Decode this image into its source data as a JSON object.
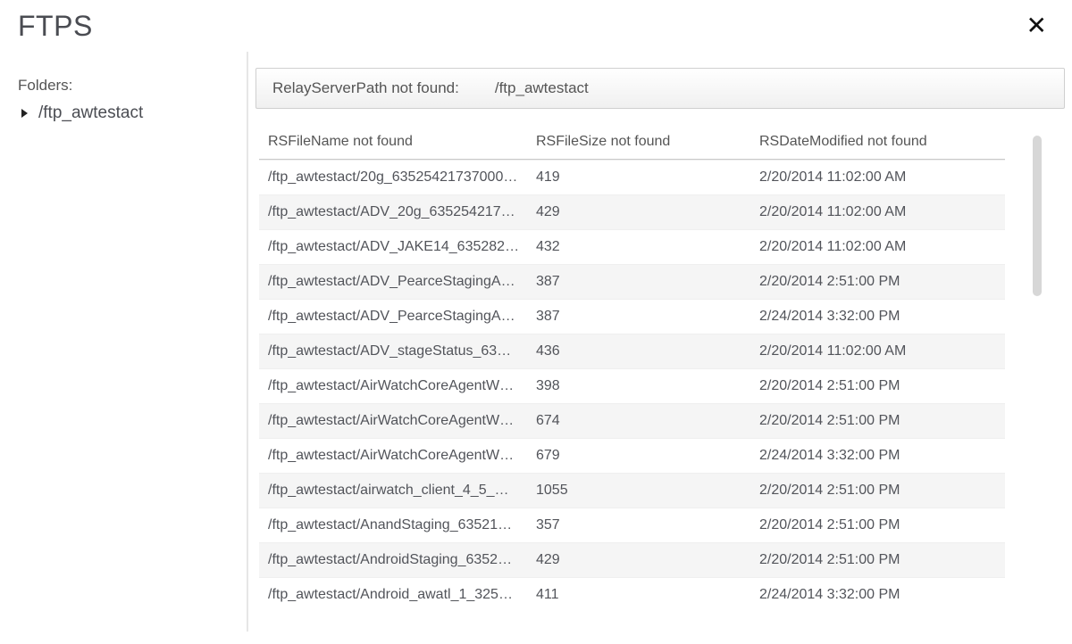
{
  "header": {
    "title": "FTPS"
  },
  "sidebar": {
    "label": "Folders:",
    "folder": "/ftp_awtestact"
  },
  "pathbar": {
    "label": "RelayServerPath not found:",
    "value": "/ftp_awtestact"
  },
  "table": {
    "columns": {
      "name": "RSFileName not found",
      "size": "RSFileSize not found",
      "modified": "RSDateModified not found"
    },
    "rows": [
      {
        "name": "/ftp_awtestact/20g_63525421737000…",
        "size": "419",
        "modified": "2/20/2014 11:02:00 AM"
      },
      {
        "name": "/ftp_awtestact/ADV_20g_635254217…",
        "size": "429",
        "modified": "2/20/2014 11:02:00 AM"
      },
      {
        "name": "/ftp_awtestact/ADV_JAKE14_635282…",
        "size": "432",
        "modified": "2/20/2014 11:02:00 AM"
      },
      {
        "name": "/ftp_awtestact/ADV_PearceStagingA…",
        "size": "387",
        "modified": "2/20/2014 2:51:00 PM"
      },
      {
        "name": "/ftp_awtestact/ADV_PearceStagingA…",
        "size": "387",
        "modified": "2/24/2014 3:32:00 PM"
      },
      {
        "name": "/ftp_awtestact/ADV_stageStatus_63…",
        "size": "436",
        "modified": "2/20/2014 11:02:00 AM"
      },
      {
        "name": "/ftp_awtestact/AirWatchCoreAgentW…",
        "size": "398",
        "modified": "2/20/2014 2:51:00 PM"
      },
      {
        "name": "/ftp_awtestact/AirWatchCoreAgentW…",
        "size": "674",
        "modified": "2/20/2014 2:51:00 PM"
      },
      {
        "name": "/ftp_awtestact/AirWatchCoreAgentW…",
        "size": "679",
        "modified": "2/24/2014 3:32:00 PM"
      },
      {
        "name": "/ftp_awtestact/airwatch_client_4_5_…",
        "size": "1055",
        "modified": "2/20/2014 2:51:00 PM"
      },
      {
        "name": "/ftp_awtestact/AnandStaging_63521…",
        "size": "357",
        "modified": "2/20/2014 2:51:00 PM"
      },
      {
        "name": "/ftp_awtestact/AndroidStaging_6352…",
        "size": "429",
        "modified": "2/20/2014 2:51:00 PM"
      },
      {
        "name": "/ftp_awtestact/Android_awatl_1_325…",
        "size": "411",
        "modified": "2/24/2014 3:32:00 PM"
      }
    ]
  }
}
